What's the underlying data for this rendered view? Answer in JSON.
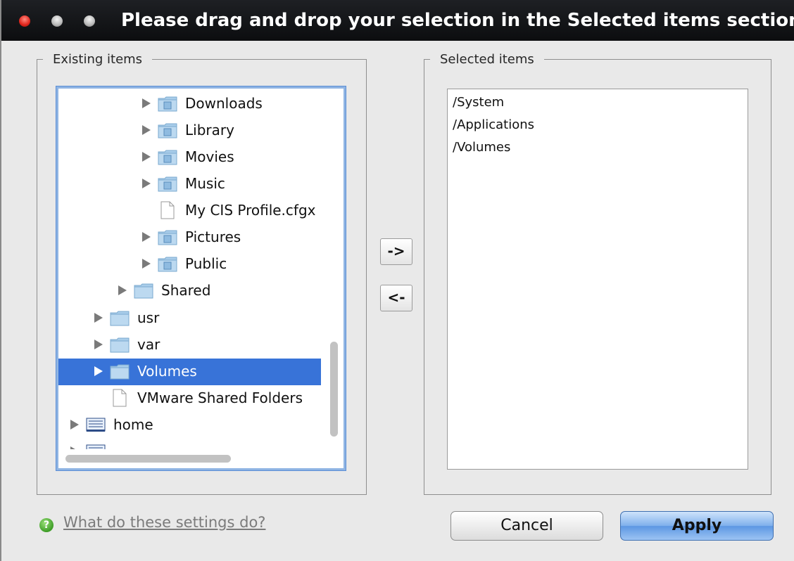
{
  "window": {
    "title": "Please drag and drop your selection in the Selected items section"
  },
  "existing_items": {
    "legend": "Existing items",
    "tree": [
      {
        "label": "Downloads",
        "icon": "downloads-folder-icon",
        "expandable": true,
        "selected": false
      },
      {
        "label": "Library",
        "icon": "library-folder-icon",
        "expandable": true,
        "selected": false
      },
      {
        "label": "Movies",
        "icon": "movies-folder-icon",
        "expandable": true,
        "selected": false
      },
      {
        "label": "Music",
        "icon": "music-folder-icon",
        "expandable": true,
        "selected": false
      },
      {
        "label": "My CIS Profile.cfgx",
        "icon": "file-icon",
        "expandable": false,
        "selected": false
      },
      {
        "label": "Pictures",
        "icon": "pictures-folder-icon",
        "expandable": true,
        "selected": false
      },
      {
        "label": "Public",
        "icon": "public-folder-icon",
        "expandable": true,
        "selected": false
      },
      {
        "label": "Shared",
        "icon": "folder-icon",
        "expandable": true,
        "selected": false
      },
      {
        "label": "usr",
        "icon": "folder-icon",
        "expandable": true,
        "selected": false
      },
      {
        "label": "var",
        "icon": "folder-icon",
        "expandable": true,
        "selected": false
      },
      {
        "label": "Volumes",
        "icon": "folder-icon",
        "expandable": true,
        "selected": true
      },
      {
        "label": "VMware Shared Folders",
        "icon": "file-icon",
        "expandable": false,
        "selected": false
      },
      {
        "label": "home",
        "icon": "network-drive-icon",
        "expandable": true,
        "selected": false
      },
      {
        "label": "",
        "icon": "network-drive-icon",
        "expandable": true,
        "selected": false
      }
    ]
  },
  "selected_items": {
    "legend": "Selected items",
    "items": [
      "/System",
      "/Applications",
      "/Volumes"
    ]
  },
  "move_buttons": {
    "add_label": "->",
    "remove_label": "<-"
  },
  "footer": {
    "help_link": "What do these settings do?",
    "help_icon": "?",
    "cancel_label": "Cancel",
    "apply_label": "Apply"
  },
  "colors": {
    "selection": "#3873d8",
    "folder": "#a9cdea",
    "apply_button": "#5c97e3"
  }
}
